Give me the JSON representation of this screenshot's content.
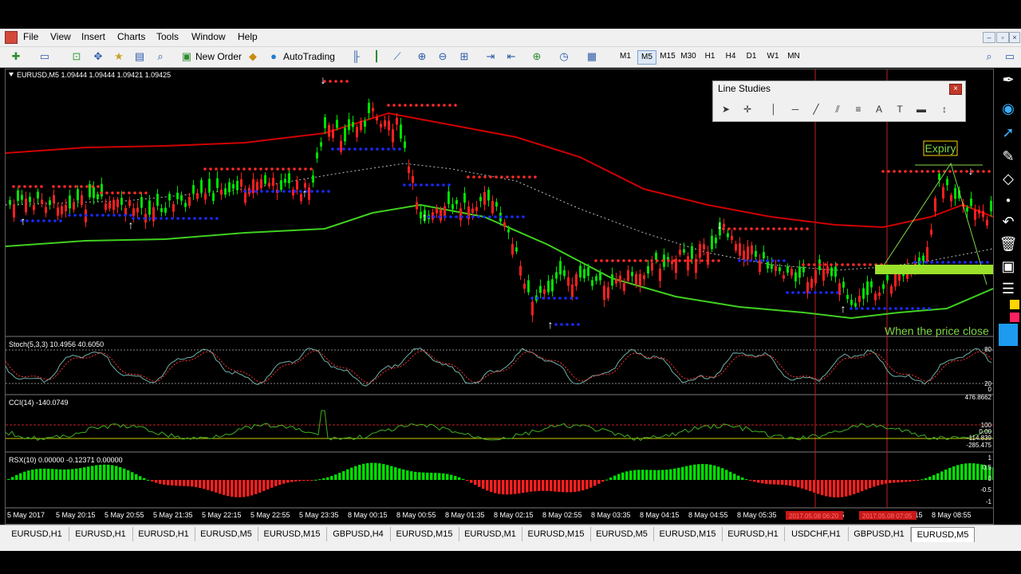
{
  "menu": [
    "File",
    "View",
    "Insert",
    "Charts",
    "Tools",
    "Window",
    "Help"
  ],
  "toolbar": {
    "new_order": "New Order",
    "autotrading": "AutoTrading",
    "timeframes": [
      "M1",
      "M5",
      "M15",
      "M30",
      "H1",
      "H4",
      "D1",
      "W1",
      "MN"
    ],
    "active_timeframe": "M5"
  },
  "chart": {
    "header": "EURUSD,M5  1.09444 1.09444 1.09421 1.09425",
    "stoch_label": "Stoch(5,3,3) 10.4956 40.6050",
    "cci_label": "CCI(14) -140.0749",
    "rsx_label": "RSX(10) 0.00000 -0.12371 0.00000",
    "stoch_scale": [
      "80",
      "20",
      "0"
    ],
    "cci_scale": [
      "476.8662",
      "100",
      "0.00",
      "-114.839",
      "-285.475"
    ],
    "rsx_scale": [
      "1",
      "0.5",
      "0",
      "-0.5",
      "-1"
    ],
    "time_labels": [
      "5 May 2017",
      "5 May 20:15",
      "5 May 20:55",
      "5 May 21:35",
      "5 May 22:15",
      "5 May 22:55",
      "5 May 23:35",
      "8 May 00:15",
      "8 May 00:55",
      "8 May 01:35",
      "8 May 02:15",
      "8 May 02:55",
      "8 May 03:35",
      "8 May 04:15",
      "8 May 04:55",
      "8 May 05:35",
      "8 M",
      "6:5",
      "8 May 08:15",
      "8 May 08:55"
    ],
    "annotation_expiry": "Expiry",
    "annotation_close": "When the price close",
    "red_time_1": "2017.05.08 06:20",
    "red_time_2": "2017.05.08 07:05"
  },
  "line_studies": {
    "title": "Line Studies",
    "tools": [
      "cursor",
      "crosshair",
      "vertical-line",
      "horizontal-line",
      "trendline",
      "equidistant-channel",
      "fibo-retracement",
      "text",
      "text-label",
      "rectangle",
      "arrows"
    ]
  },
  "tabs": [
    "EURUSD,H1",
    "EURUSD,H1",
    "EURUSD,H1",
    "EURUSD,M5",
    "EURUSD,M15",
    "GBPUSD,H4",
    "EURUSD,M15",
    "EURUSD,M1",
    "EURUSD,M15",
    "EURUSD,M5",
    "EURUSD,M15",
    "EURUSD,H1",
    "USDCHF,H1",
    "GBPUSD,H1",
    "EURUSD,M5"
  ],
  "active_tab_index": 14,
  "colors": {
    "bull": "#00e000",
    "bear": "#ff2020",
    "upper_band": "#d00000",
    "lower_band": "#40d020",
    "dot_red": "#ff2a2a",
    "dot_blue": "#1a2aff",
    "stoch_main": "#6fb0a8",
    "stoch_signal": "#ff3030",
    "cci_line": "#40b020",
    "annotation": "#7fd64a",
    "expiry_box": "#ffd000"
  }
}
